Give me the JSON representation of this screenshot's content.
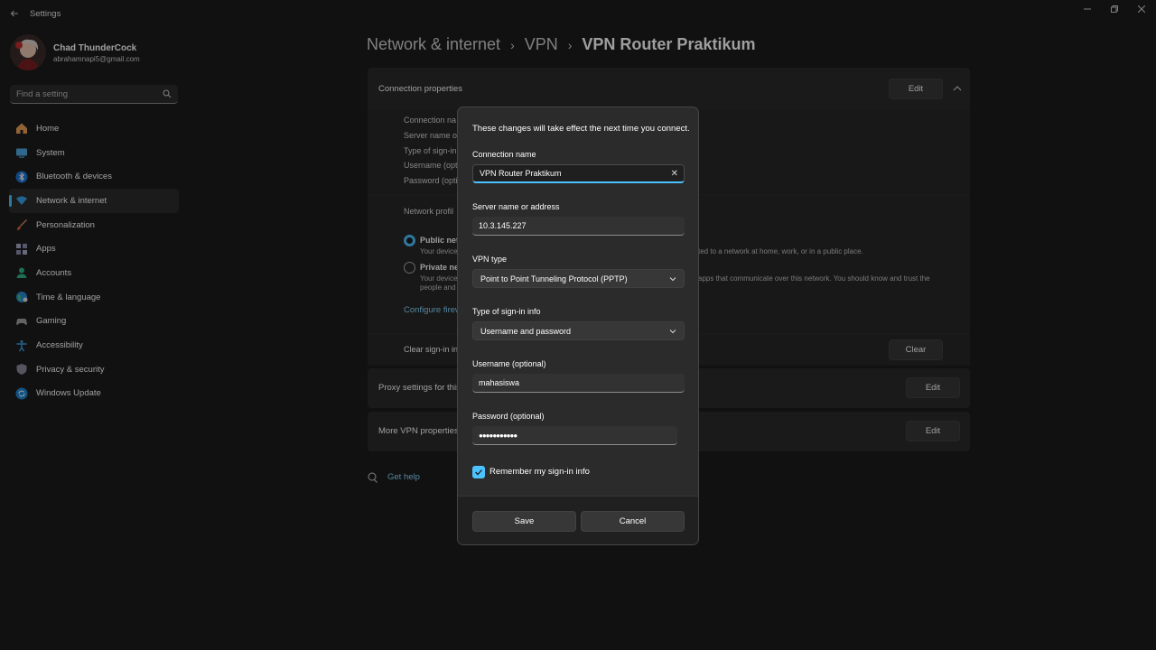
{
  "window": {
    "title": "Settings",
    "back_icon": "back-arrow-icon"
  },
  "profile": {
    "name": "Chad ThunderCock",
    "email": "abrahamnapi5@gmail.com"
  },
  "search": {
    "placeholder": "Find a setting"
  },
  "sidebar": {
    "items": [
      {
        "label": "Home",
        "icon": "home-icon"
      },
      {
        "label": "System",
        "icon": "system-icon"
      },
      {
        "label": "Bluetooth & devices",
        "icon": "bluetooth-icon"
      },
      {
        "label": "Network & internet",
        "icon": "network-icon",
        "active": true
      },
      {
        "label": "Personalization",
        "icon": "brush-icon"
      },
      {
        "label": "Apps",
        "icon": "apps-icon"
      },
      {
        "label": "Accounts",
        "icon": "accounts-icon"
      },
      {
        "label": "Time & language",
        "icon": "globe-icon"
      },
      {
        "label": "Gaming",
        "icon": "gamepad-icon"
      },
      {
        "label": "Accessibility",
        "icon": "accessibility-icon"
      },
      {
        "label": "Privacy & security",
        "icon": "shield-icon"
      },
      {
        "label": "Windows Update",
        "icon": "update-icon"
      }
    ]
  },
  "breadcrumb": {
    "part1": "Network & internet",
    "part2": "VPN",
    "current": "VPN Router Praktikum"
  },
  "background": {
    "connection_properties": "Connection properties",
    "edit": "Edit",
    "prop_rows": [
      "Connection na",
      "Server name o",
      "Type of sign-in",
      "Username (opt",
      "Password (optio"
    ],
    "network_profile": "Network profil",
    "public_label": "Public net",
    "public_desc1": "Your device",
    "public_desc_right": "ted to a network at home, work, or in a public place.",
    "private_label": "Private ne",
    "private_desc1": "Your device",
    "private_desc2": "people and",
    "private_desc_right": "apps that communicate over this network. You should know and trust the",
    "configure_firewall": "Configure firew",
    "clear_signin": "Clear sign-in in",
    "clear": "Clear",
    "proxy_settings": "Proxy settings for this",
    "more_vpn": "More VPN properties",
    "get_help": "Get help"
  },
  "dialog": {
    "note": "These changes will take effect the next time you connect.",
    "connection_name_label": "Connection name",
    "connection_name_value": "VPN Router Praktikum",
    "server_label": "Server name or address",
    "server_value": "10.3.145.227",
    "vpn_type_label": "VPN type",
    "vpn_type_value": "Point to Point Tunneling Protocol (PPTP)",
    "signin_type_label": "Type of sign-in info",
    "signin_type_value": "Username and password",
    "username_label": "Username (optional)",
    "username_value": "mahasiswa",
    "password_label": "Password (optional)",
    "password_value": "●●●●●●●●●●●",
    "remember_label": "Remember my sign-in info",
    "remember_checked": true,
    "save": "Save",
    "cancel": "Cancel"
  },
  "colors": {
    "accent": "#4cc2ff",
    "background": "#1c1c1c",
    "card": "#2b2b2b"
  }
}
